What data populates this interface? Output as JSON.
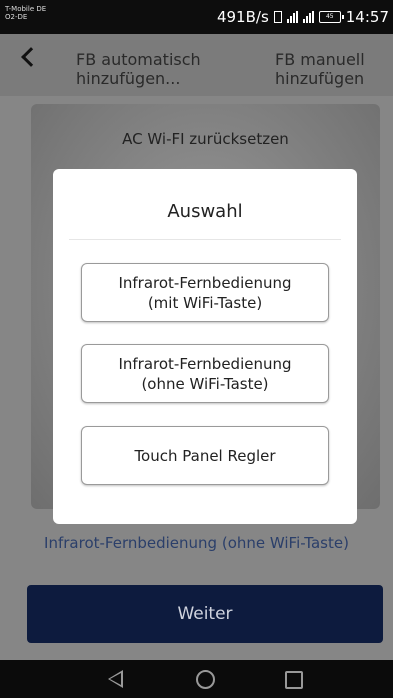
{
  "status_bar": {
    "carrier_line1": "T-Mobile DE",
    "carrier_line2": "O2-DE",
    "network_speed": "491B/s",
    "network_type": "4G",
    "battery_level": "45",
    "time": "14:57"
  },
  "header": {
    "back_icon": "chevron-left-icon",
    "tab_auto": "FB automatisch hinzufügen...",
    "tab_manual": "FB manuell hinzufügen"
  },
  "background": {
    "photo_title": "AC Wi-FI zurücksetzen",
    "selected_link": "Infrarot-Fernbedienung (ohne WiFi-Taste)",
    "next_label": "Weiter"
  },
  "dialog": {
    "title": "Auswahl",
    "options": [
      {
        "line1": "Infrarot-Fernbedienung",
        "line2": "(mit WiFi-Taste)"
      },
      {
        "line1": "Infrarot-Fernbedienung",
        "line2": "(ohne WiFi-Taste)"
      },
      {
        "line1": "Touch Panel Regler",
        "line2": ""
      }
    ]
  },
  "navigation": {
    "back_icon": "triangle-back-icon",
    "home_icon": "circle-home-icon",
    "recent_icon": "square-recent-icon"
  }
}
